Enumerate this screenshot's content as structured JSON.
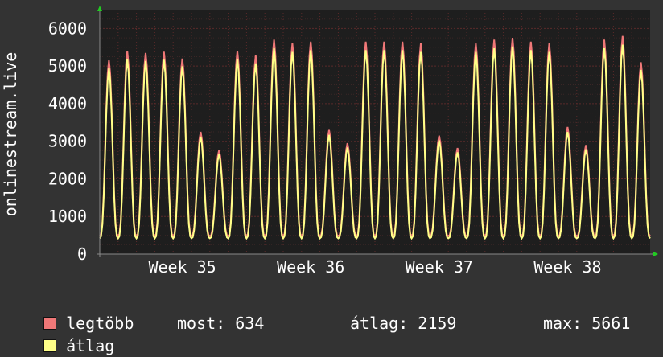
{
  "chart_data": {
    "type": "line",
    "ylabel": "onlinestream.live",
    "ylim": [
      0,
      6500
    ],
    "yticks": [
      0,
      1000,
      2000,
      3000,
      4000,
      5000,
      6000
    ],
    "xticks": [
      "Week 35",
      "Week 36",
      "Week 37",
      "Week 38"
    ],
    "grid": true,
    "colors": {
      "background": "#333333",
      "plot_area": "#1e1e1e",
      "grid": "#5a2a2a",
      "max_series": "#f07878",
      "avg_series": "#ffff88",
      "axis_arrow": "#22cc22"
    },
    "days": 30,
    "daily_peaks": [
      5150,
      5400,
      5350,
      5380,
      5200,
      3250,
      2760,
      5400,
      5280,
      5700,
      5600,
      5650,
      3300,
      2950,
      5650,
      5650,
      5650,
      5600,
      3150,
      2820,
      5600,
      5700,
      5750,
      5650,
      5600,
      3380,
      2900,
      5700,
      5800,
      5100
    ],
    "series": [
      {
        "name": "legtöbb",
        "kind": "max"
      },
      {
        "name": "átlag",
        "kind": "avg"
      }
    ],
    "stats": {
      "most_label": "most:",
      "most_value": "634",
      "avg_label": "átlag:",
      "avg_value": "2159",
      "max_label": "max:",
      "max_value": "5661"
    }
  }
}
